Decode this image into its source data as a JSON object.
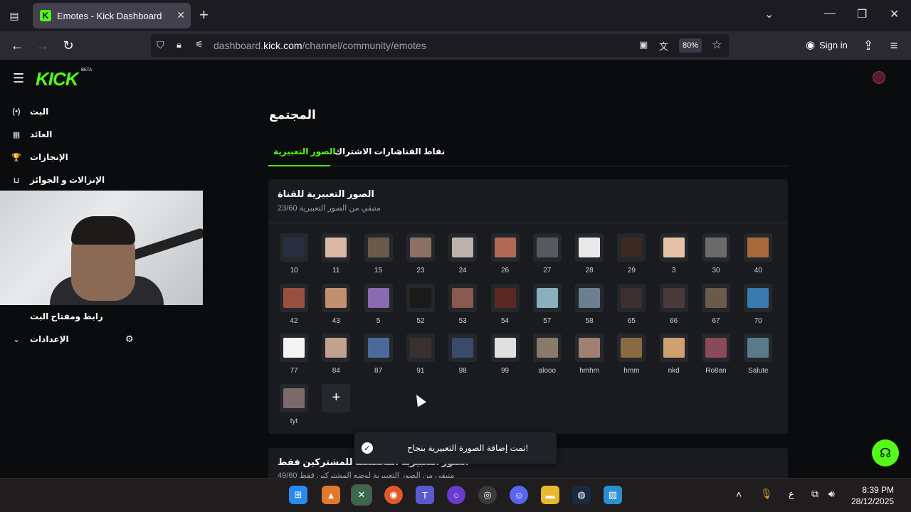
{
  "browser": {
    "tab_title": "Emotes - Kick Dashboard",
    "tab_favicon": "K",
    "url_prefix": "dashboard.",
    "url_domain": "kick.com",
    "url_path": "/channel/community/emotes",
    "zoom": "80%",
    "sign_in": "Sign in"
  },
  "app": {
    "logo": "KICK",
    "logo_badge": "BETA"
  },
  "sidebar": {
    "items": [
      {
        "label": "البث",
        "icon": "(•)"
      },
      {
        "label": "العائد",
        "icon": "▦"
      },
      {
        "label": "الإنجازات",
        "icon": "🏆"
      },
      {
        "label": "الإنزالات و الجوائز",
        "icon": "⊔"
      },
      {
        "label": "رابط ومفتاح البث",
        "icon": ""
      },
      {
        "label": "الإعدادات",
        "icon": "⌄"
      }
    ],
    "settings_icon": "⚙"
  },
  "main": {
    "title": "المجتمع",
    "tabs": [
      "الصور التعبيرية",
      "شارات الاشتراك",
      "نقاط القناة"
    ],
    "card": {
      "title": "الصور التعبيرية للقناة",
      "subtitle": "متبقي من الصور التعبيرية 23/60",
      "add_label": "+"
    },
    "emotes": [
      {
        "name": "10",
        "color": "#2a3040"
      },
      {
        "name": "11",
        "color": "#d9b7a5"
      },
      {
        "name": "15",
        "color": "#6a5a4a"
      },
      {
        "name": "23",
        "color": "#8c7064"
      },
      {
        "name": "24",
        "color": "#bdb3a8"
      },
      {
        "name": "26",
        "color": "#b06a55"
      },
      {
        "name": "27",
        "color": "#555a5f"
      },
      {
        "name": "28",
        "color": "#e9e9e9"
      },
      {
        "name": "29",
        "color": "#3a2a22"
      },
      {
        "name": "3",
        "color": "#e6c2a8"
      },
      {
        "name": "30",
        "color": "#6a6a6a"
      },
      {
        "name": "40",
        "color": "#a86a3a"
      },
      {
        "name": "42",
        "color": "#9a5040"
      },
      {
        "name": "43",
        "color": "#c09070"
      },
      {
        "name": "5",
        "color": "#8a6ab0"
      },
      {
        "name": "52",
        "color": "#1a1a18"
      },
      {
        "name": "53",
        "color": "#8a5a50"
      },
      {
        "name": "54",
        "color": "#5a2a22"
      },
      {
        "name": "57",
        "color": "#8ab0c0"
      },
      {
        "name": "58",
        "color": "#6a8090"
      },
      {
        "name": "65",
        "color": "#3a3030"
      },
      {
        "name": "66",
        "color": "#4a3a3a"
      },
      {
        "name": "67",
        "color": "#6a5a4a"
      },
      {
        "name": "70",
        "color": "#3a7ab0"
      },
      {
        "name": "77",
        "color": "#f4f4f4"
      },
      {
        "name": "84",
        "color": "#c4a090"
      },
      {
        "name": "87",
        "color": "#4a6a9a"
      },
      {
        "name": "91",
        "color": "#3a3030"
      },
      {
        "name": "98",
        "color": "#3a4a6a"
      },
      {
        "name": "99",
        "color": "#e0e0e0"
      },
      {
        "name": "alooo",
        "color": "#8a7a6a"
      },
      {
        "name": "hmhm",
        "color": "#a08070"
      },
      {
        "name": "hmm",
        "color": "#8a6a40"
      },
      {
        "name": "nkd",
        "color": "#d0a070"
      },
      {
        "name": "Ro8an",
        "color": "#8a4a5a"
      },
      {
        "name": "Salute",
        "color": "#5a7a8a"
      },
      {
        "name": "tyt",
        "color": "#7a6a6a"
      }
    ],
    "card2": {
      "title": "الصور التعبيرية المخصصة للمشتركين فقط",
      "subtitle": "متبقي من الصور التعبيرية لوضع المشتركين فقط 49/60"
    },
    "toast": "تمت إضافة الصورة التعبيرية بنجاح!"
  },
  "taskbar": {
    "time": "8:39 PM",
    "date": "28/12/2025",
    "lang": "ع"
  },
  "colors": {
    "accent": "#53fc18",
    "bg": "#0b0c0d",
    "card": "#191b1f"
  }
}
